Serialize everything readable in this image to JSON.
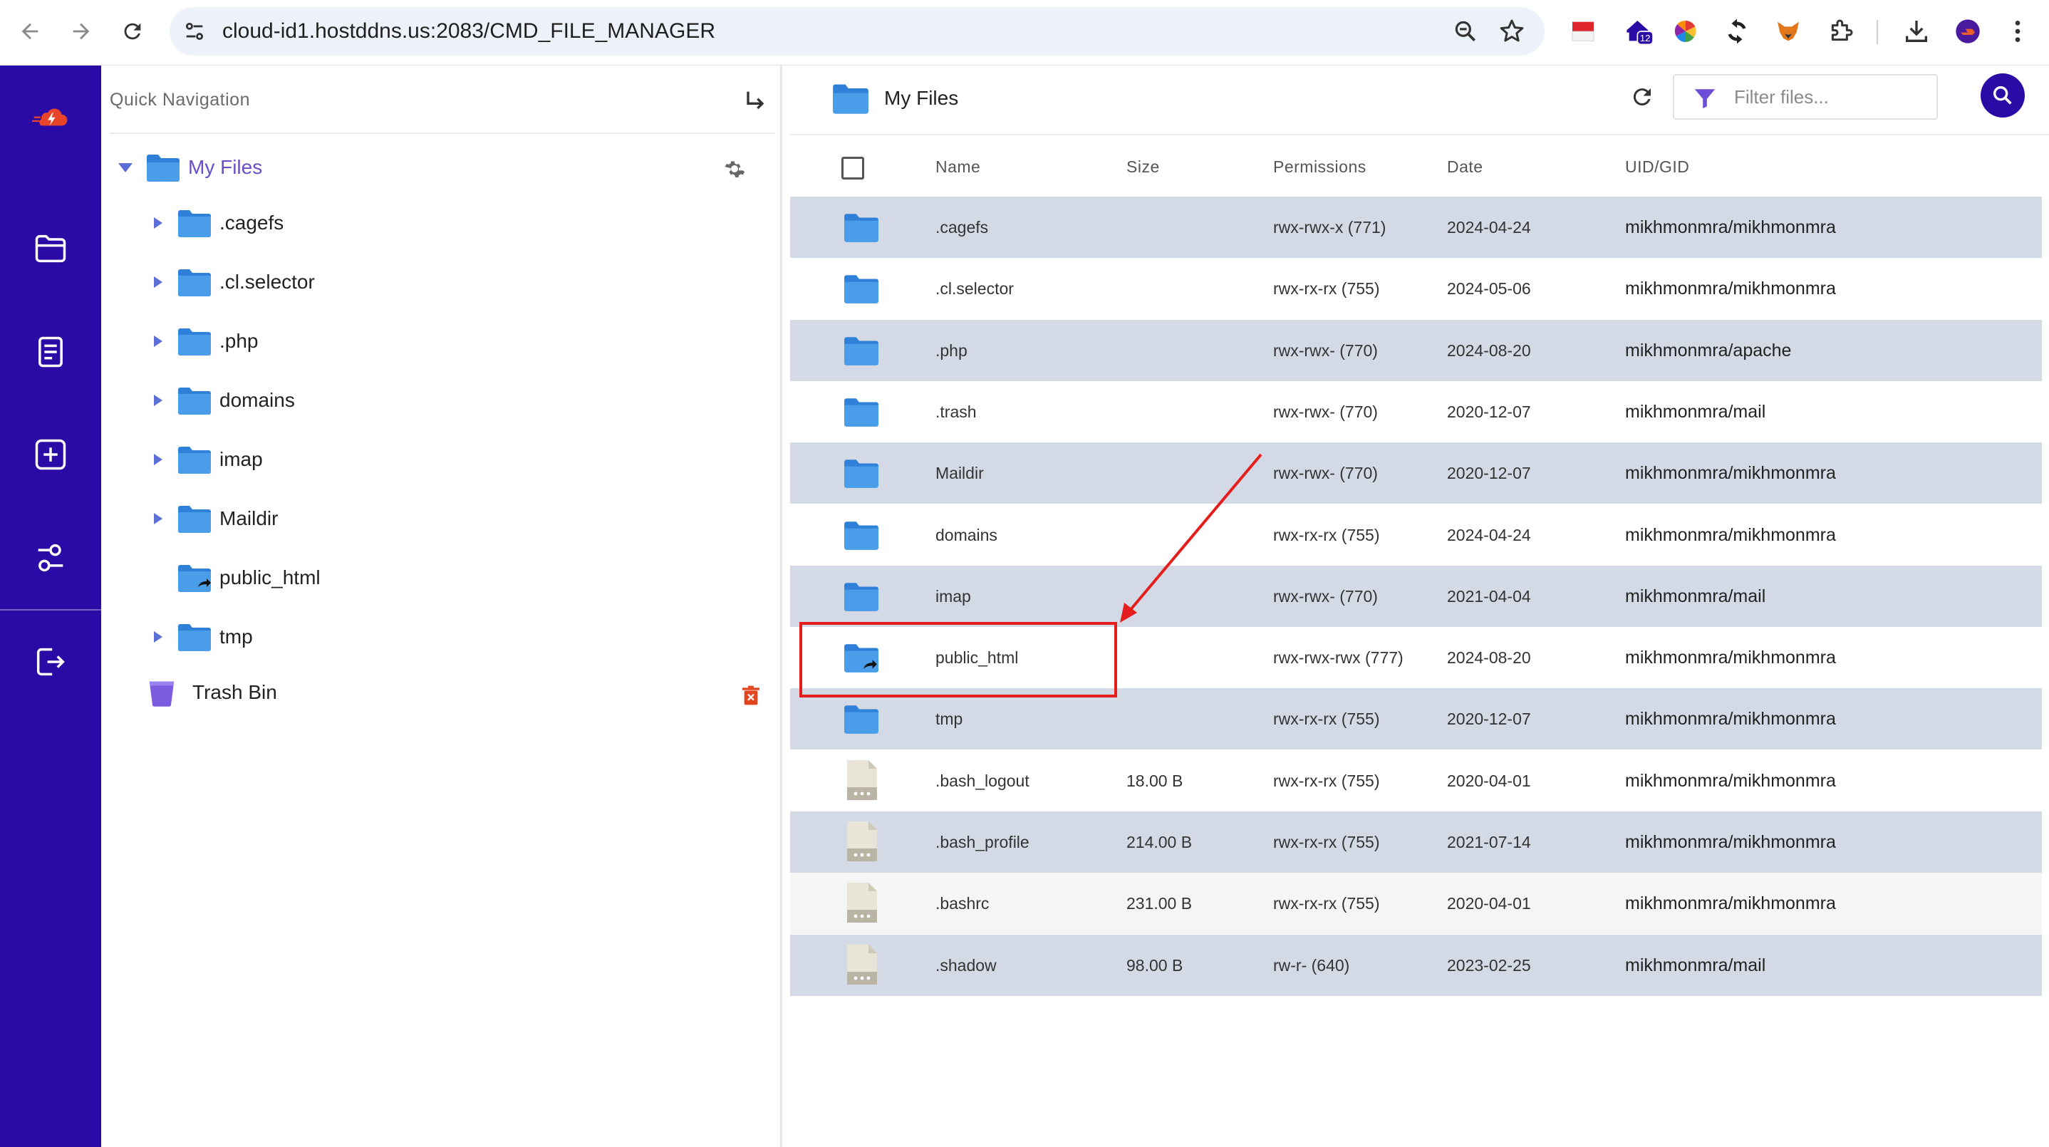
{
  "browser": {
    "url": "cloud-id1.hostddns.us:2083/CMD_FILE_MANAGER",
    "extension_badge": "12"
  },
  "quick_nav": {
    "title": "Quick Navigation",
    "root_label": "My Files",
    "items": [
      {
        "label": ".cagefs"
      },
      {
        "label": ".cl.selector"
      },
      {
        "label": ".php"
      },
      {
        "label": "domains"
      },
      {
        "label": "imap"
      },
      {
        "label": "Maildir"
      },
      {
        "label": "public_html"
      },
      {
        "label": "tmp"
      }
    ],
    "trash_label": "Trash Bin"
  },
  "file_list": {
    "title": "My Files",
    "filter_placeholder": "Filter files...",
    "columns": {
      "name": "Name",
      "size": "Size",
      "permissions": "Permissions",
      "date": "Date",
      "uid": "UID/GID"
    },
    "rows": [
      {
        "name": ".cagefs",
        "size": "",
        "permissions": "rwx-rwx-x (771)",
        "date": "2024-04-24",
        "uid": "mikhmonmra/mikhmonmra"
      },
      {
        "name": ".cl.selector",
        "size": "",
        "permissions": "rwx-rx-rx (755)",
        "date": "2024-05-06",
        "uid": "mikhmonmra/mikhmonmra"
      },
      {
        "name": ".php",
        "size": "",
        "permissions": "rwx-rwx- (770)",
        "date": "2024-08-20",
        "uid": "mikhmonmra/apache"
      },
      {
        "name": ".trash",
        "size": "",
        "permissions": "rwx-rwx- (770)",
        "date": "2020-12-07",
        "uid": "mikhmonmra/mail"
      },
      {
        "name": "Maildir",
        "size": "",
        "permissions": "rwx-rwx- (770)",
        "date": "2020-12-07",
        "uid": "mikhmonmra/mikhmonmra"
      },
      {
        "name": "domains",
        "size": "",
        "permissions": "rwx-rx-rx (755)",
        "date": "2024-04-24",
        "uid": "mikhmonmra/mikhmonmra"
      },
      {
        "name": "imap",
        "size": "",
        "permissions": "rwx-rwx- (770)",
        "date": "2021-04-04",
        "uid": "mikhmonmra/mail"
      },
      {
        "name": "public_html",
        "size": "",
        "permissions": "rwx-rwx-rwx (777)",
        "date": "2024-08-20",
        "uid": "mikhmonmra/mikhmonmra"
      },
      {
        "name": "tmp",
        "size": "",
        "permissions": "rwx-rx-rx (755)",
        "date": "2020-12-07",
        "uid": "mikhmonmra/mikhmonmra"
      },
      {
        "name": ".bash_logout",
        "size": "18.00 B",
        "permissions": "rwx-rx-rx (755)",
        "date": "2020-04-01",
        "uid": "mikhmonmra/mikhmonmra"
      },
      {
        "name": ".bash_profile",
        "size": "214.00 B",
        "permissions": "rwx-rx-rx (755)",
        "date": "2021-07-14",
        "uid": "mikhmonmra/mikhmonmra"
      },
      {
        "name": ".bashrc",
        "size": "231.00 B",
        "permissions": "rwx-rx-rx (755)",
        "date": "2020-04-01",
        "uid": "mikhmonmra/mikhmonmra"
      },
      {
        "name": ".shadow",
        "size": "98.00 B",
        "permissions": "rw-r- (640)",
        "date": "2023-02-25",
        "uid": "mikhmonmra/mail"
      }
    ]
  },
  "colors": {
    "rail": "#2b0ba6",
    "row_shade": "#d3dae6",
    "folder": "#4a9de8",
    "annotation": "#e51d1d"
  },
  "icons": {
    "folder": "folder-icon",
    "symlink_folder": "folder-symlink-icon",
    "file": "file-icon",
    "trash": "trash-icon"
  }
}
